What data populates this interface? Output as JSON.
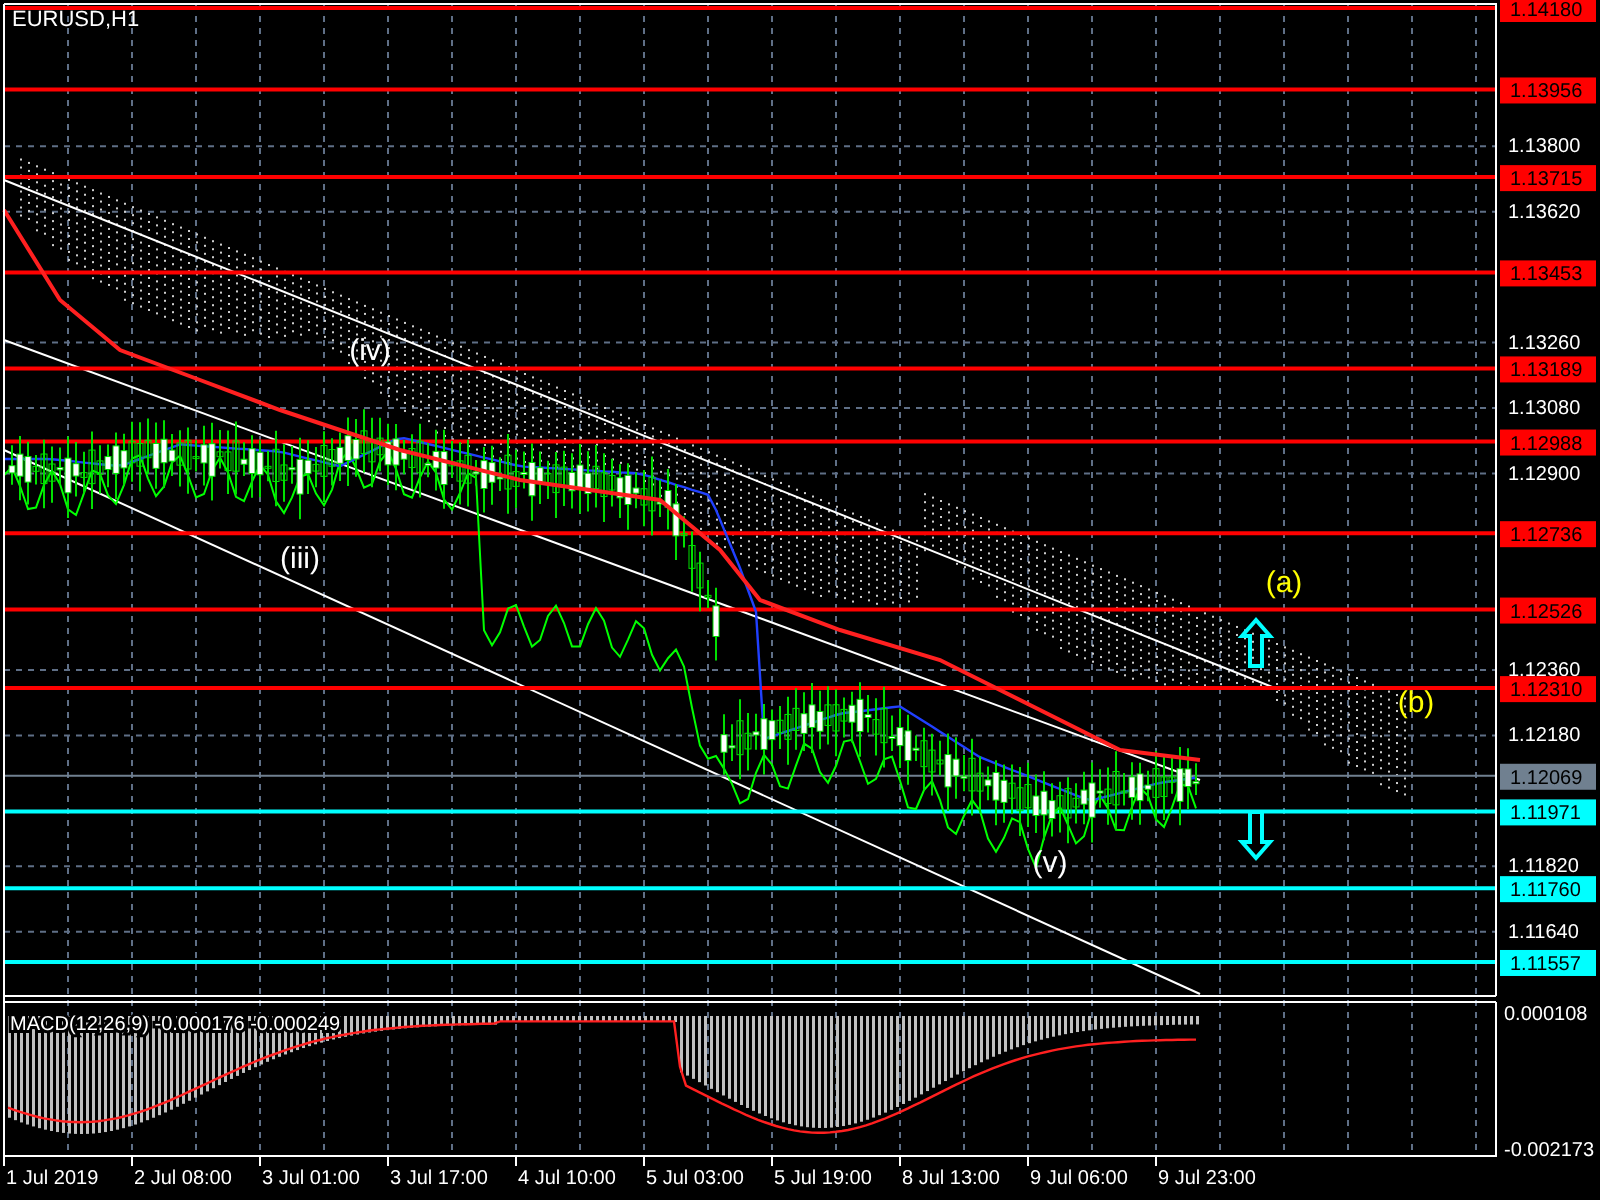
{
  "chart": {
    "symbol": "EURUSD,H1",
    "price_axis": [
      "1.13800",
      "1.13620",
      "1.13260",
      "1.13080",
      "1.12900",
      "1.12360",
      "1.12180",
      "1.11820",
      "1.11640"
    ],
    "levels": [
      {
        "label": "1.14180",
        "color": "#ff0000"
      },
      {
        "label": "1.13956",
        "color": "#ff0000"
      },
      {
        "label": "1.13715",
        "color": "#ff0000"
      },
      {
        "label": "1.13453",
        "color": "#ff0000"
      },
      {
        "label": "1.13189",
        "color": "#ff0000"
      },
      {
        "label": "1.12988",
        "color": "#ff0000"
      },
      {
        "label": "1.12736",
        "color": "#ff0000"
      },
      {
        "label": "1.12526",
        "color": "#ff0000"
      },
      {
        "label": "1.12310",
        "color": "#ff0000"
      },
      {
        "label": "1.11971",
        "color": "#00ffff"
      },
      {
        "label": "1.11760",
        "color": "#00ffff"
      },
      {
        "label": "1.11557",
        "color": "#00ffff"
      }
    ],
    "current_price": {
      "label": "1.12069"
    },
    "time_axis": [
      "1 Jul 2019",
      "2 Jul 08:00",
      "3 Jul 01:00",
      "3 Jul 17:00",
      "4 Jul 10:00",
      "5 Jul 03:00",
      "5 Jul 19:00",
      "8 Jul 13:00",
      "9 Jul 06:00",
      "9 Jul 23:00"
    ],
    "wave_labels": [
      {
        "text": "(iv)",
        "color": "#ffffff"
      },
      {
        "text": "(iii)",
        "color": "#ffffff"
      },
      {
        "text": "(v)",
        "color": "#ffffff"
      },
      {
        "text": "(a)",
        "color": "#ffff00"
      },
      {
        "text": "(b)",
        "color": "#ffff00"
      }
    ],
    "arrows": [
      {
        "kind": "up"
      },
      {
        "kind": "down"
      }
    ]
  },
  "macd": {
    "label": "MACD(12,26,9) -0.000176 -0.000249",
    "scale": [
      "0.000108",
      "-0.002173"
    ]
  }
}
